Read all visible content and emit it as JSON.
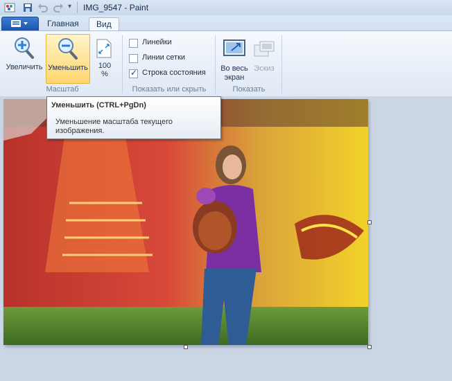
{
  "window": {
    "title": "IMG_9547 - Paint"
  },
  "tabs": [
    {
      "label": "Главная"
    },
    {
      "label": "Вид"
    }
  ],
  "ribbon": {
    "zoom_in": "Увеличить",
    "zoom_out": "Уменьшить",
    "zoom_100_line1": "100",
    "zoom_100_line2": "%",
    "group_zoom": "Масштаб",
    "rulers": "Линейки",
    "gridlines": "Линии сетки",
    "statusbar": "Строка состояния",
    "group_show": "Показать или скрыть",
    "fullscreen_line1": "Во весь",
    "fullscreen_line2": "экран",
    "thumbnail": "Эскиз",
    "group_display": "Показать"
  },
  "checks": {
    "rulers": false,
    "gridlines": false,
    "statusbar": true
  },
  "tooltip": {
    "title": "Уменьшить (CTRL+PgDn)",
    "body": "Уменьшение масштаба текущего изображения."
  },
  "icons": {
    "save": "save-icon",
    "undo": "undo-icon",
    "redo": "redo-icon",
    "zoom_in": "zoom-in-icon",
    "zoom_out": "zoom-out-icon",
    "zoom_100": "actual-size-icon",
    "fullscreen": "fullscreen-icon",
    "thumbnail": "thumbnail-icon"
  },
  "colors": {
    "accent": "#1b57b0",
    "selected": "#ffd66e",
    "background": "#cbd6e5"
  }
}
